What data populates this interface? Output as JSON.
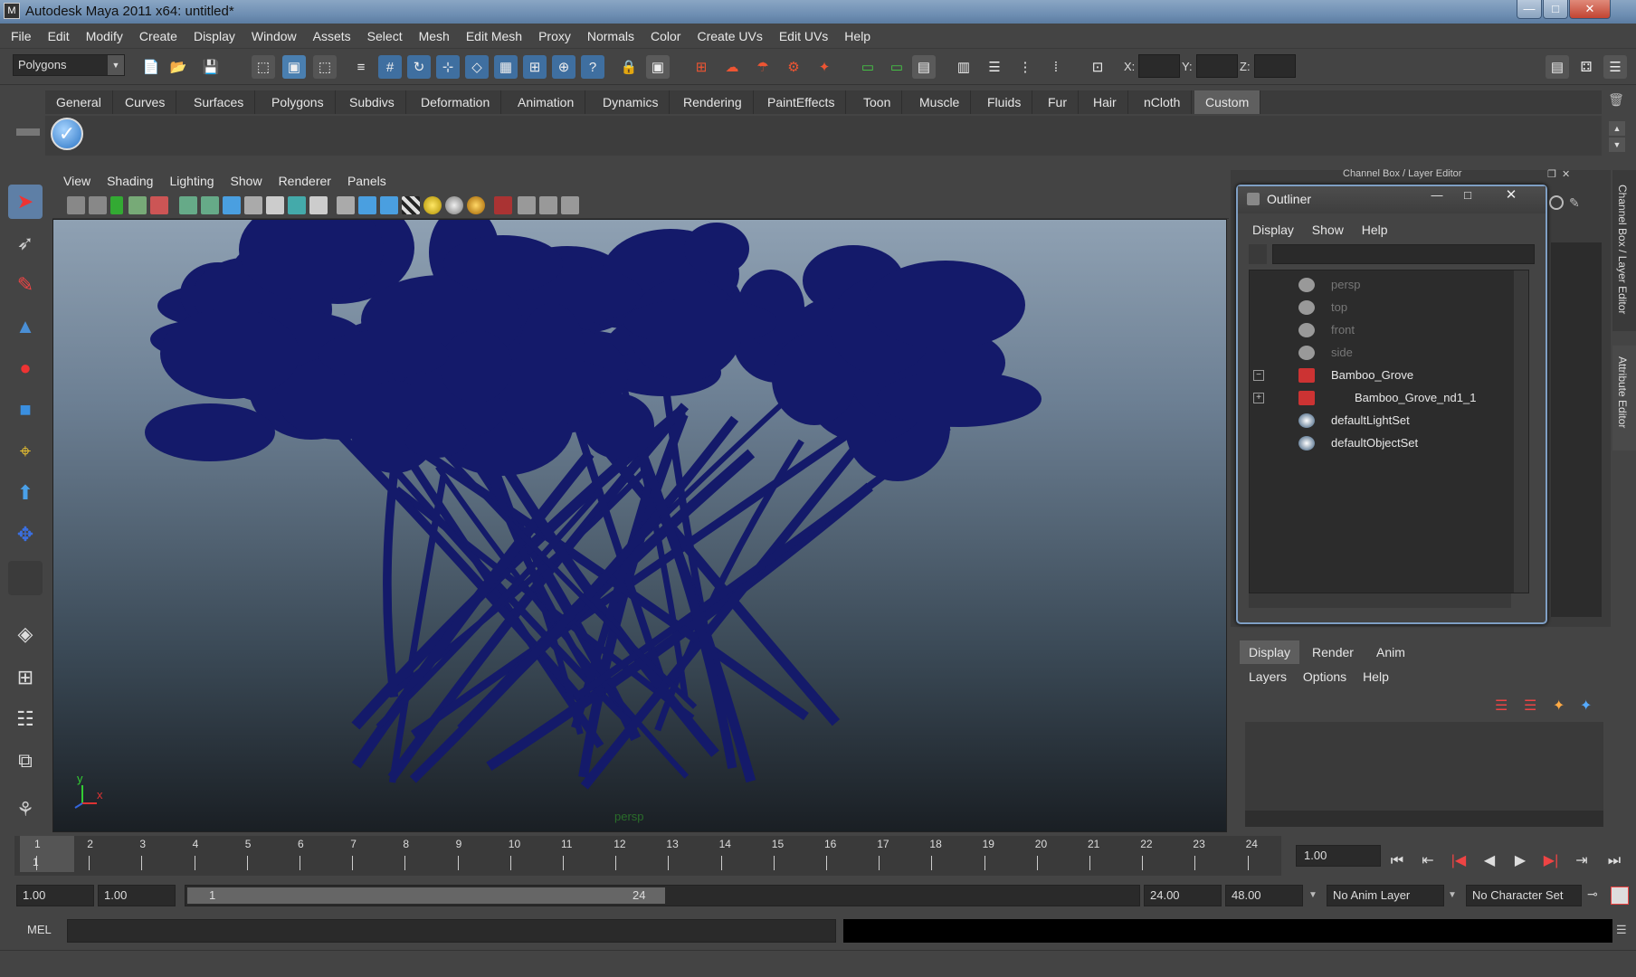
{
  "window": {
    "title": "Autodesk Maya 2011 x64: untitled*",
    "min": "—",
    "max": "□",
    "close": "✕"
  },
  "menus": [
    "File",
    "Edit",
    "Modify",
    "Create",
    "Display",
    "Window",
    "Assets",
    "Select",
    "Mesh",
    "Edit Mesh",
    "Proxy",
    "Normals",
    "Color",
    "Create UVs",
    "Edit UVs",
    "Help"
  ],
  "status": {
    "mode": "Polygons",
    "x_label": "X:",
    "y_label": "Y:",
    "z_label": "Z:"
  },
  "shelf": {
    "tabs": [
      "General",
      "Curves",
      "Surfaces",
      "Polygons",
      "Subdivs",
      "Deformation",
      "Animation",
      "Dynamics",
      "Rendering",
      "PaintEffects",
      "Toon",
      "Muscle",
      "Fluids",
      "Fur",
      "Hair",
      "nCloth",
      "Custom"
    ],
    "active": "Custom"
  },
  "viewport": {
    "menus": [
      "View",
      "Shading",
      "Lighting",
      "Show",
      "Renderer",
      "Panels"
    ],
    "camera": "persp",
    "axis_y": "y",
    "axis_x": "x",
    "tree_color": "#141a6a"
  },
  "channel_box": {
    "title": "Channel Box / Layer Editor"
  },
  "outliner": {
    "title": "Outliner",
    "menus": [
      "Display",
      "Show",
      "Help"
    ],
    "items": [
      {
        "label": "persp",
        "type": "camera",
        "dim": true
      },
      {
        "label": "top",
        "type": "camera",
        "dim": true
      },
      {
        "label": "front",
        "type": "camera",
        "dim": true
      },
      {
        "label": "side",
        "type": "camera",
        "dim": true
      },
      {
        "label": "Bamboo_Grove",
        "type": "mesh",
        "expand": "−"
      },
      {
        "label": "Bamboo_Grove_nd1_1",
        "type": "mesh",
        "expand": "+"
      },
      {
        "label": "defaultLightSet",
        "type": "set"
      },
      {
        "label": "defaultObjectSet",
        "type": "set"
      }
    ]
  },
  "layer_editor": {
    "tabs": [
      "Display",
      "Render",
      "Anim"
    ],
    "active": "Display",
    "menus": [
      "Layers",
      "Options",
      "Help"
    ]
  },
  "side_tabs": {
    "channel_box": "Channel Box / Layer Editor",
    "attribute_editor": "Attribute Editor"
  },
  "timeline": {
    "frames": [
      "1",
      "2",
      "3",
      "4",
      "5",
      "6",
      "7",
      "8",
      "9",
      "10",
      "11",
      "12",
      "13",
      "14",
      "15",
      "16",
      "17",
      "18",
      "19",
      "20",
      "21",
      "22",
      "23",
      "24"
    ],
    "current": "1",
    "current_field": "1.00"
  },
  "range": {
    "start": "1.00",
    "start2": "1.00",
    "slider_start": "1",
    "slider_end": "24",
    "end": "24.00",
    "end2": "48.00",
    "anim_layer": "No Anim Layer",
    "char_set": "No Character Set"
  },
  "cmd": {
    "label": "MEL"
  }
}
